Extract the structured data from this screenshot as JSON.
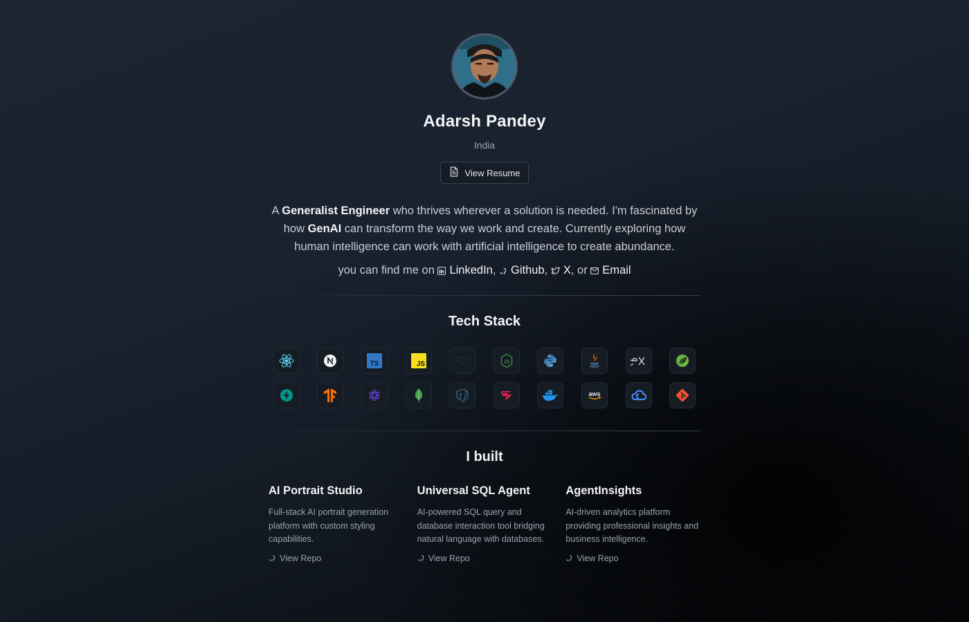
{
  "profile": {
    "name": "Adarsh Pandey",
    "location": "India",
    "resume_label": "View Resume"
  },
  "bio": {
    "p1": "A ",
    "b1": "Generalist Engineer",
    "p2": " who thrives wherever a solution is needed. I'm fascinated by how ",
    "b2": "GenAI",
    "p3": " can transform the way we work and create. Currently exploring how human intelligence can work with artificial intelligence to create abundance."
  },
  "find": {
    "prefix": "you can find me on",
    "linkedin": "LinkedIn",
    "github": "Github",
    "x": "X",
    "or": "or",
    "email": "Email"
  },
  "tech": {
    "title": "Tech Stack",
    "items": [
      {
        "icon": "react-icon",
        "color": "#61dafb"
      },
      {
        "icon": "nextjs-icon",
        "color": "#ffffff"
      },
      {
        "icon": "typescript-icon",
        "color": "#3178c6"
      },
      {
        "icon": "javascript-icon",
        "color": "#f7df1e"
      },
      {
        "icon": "tailwind-icon",
        "color": "#38bdf8"
      },
      {
        "icon": "nodejs-icon",
        "color": "#3c873a"
      },
      {
        "icon": "python-icon",
        "color": "#3776ab"
      },
      {
        "icon": "java-icon",
        "color": "#e76f00"
      },
      {
        "icon": "express-icon",
        "color": "#e5e7eb"
      },
      {
        "icon": "spring-icon",
        "color": "#6db33f"
      },
      {
        "icon": "fastapi-icon",
        "color": "#059487"
      },
      {
        "icon": "tensorflow-icon",
        "color": "#ff6f00"
      },
      {
        "icon": "openai-icon",
        "color": "#5b3fc4"
      },
      {
        "icon": "mongodb-icon",
        "color": "#47a248"
      },
      {
        "icon": "postgresql-icon",
        "color": "#336791"
      },
      {
        "icon": "nestjs-icon",
        "color": "#e0234e"
      },
      {
        "icon": "docker-icon",
        "color": "#2496ed"
      },
      {
        "icon": "aws-icon",
        "color": "#ff9900"
      },
      {
        "icon": "google-cloud-icon",
        "color": "#4285f4"
      },
      {
        "icon": "git-icon",
        "color": "#f05032"
      }
    ]
  },
  "built": {
    "title": "I built",
    "projects": [
      {
        "title": "AI Portrait Studio",
        "desc": "Full-stack AI portrait generation platform with custom styling capabilities.",
        "link": "View Repo"
      },
      {
        "title": "Universal SQL Agent",
        "desc": "AI-powered SQL query and database interaction tool bridging natural language with databases.",
        "link": "View Repo"
      },
      {
        "title": "AgentInsights",
        "desc": "AI-driven analytics platform providing professional insights and business intelligence.",
        "link": "View Repo"
      }
    ]
  }
}
